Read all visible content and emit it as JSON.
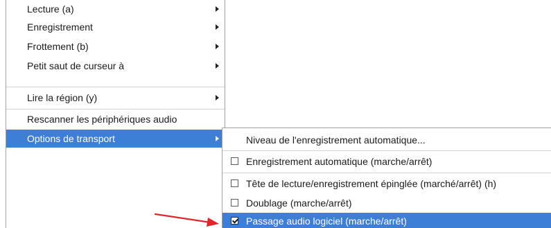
{
  "main_menu": {
    "items": [
      {
        "label": "Lecture (a)",
        "has_submenu": true
      },
      {
        "label": "Enregistrement",
        "has_submenu": true
      },
      {
        "label": "Frottement (b)",
        "has_submenu": true
      },
      {
        "label": "Petit saut de curseur à",
        "has_submenu": true
      },
      {
        "label": "Lire la région (y)",
        "has_submenu": true
      },
      {
        "label": "Rescanner les périphériques audio",
        "has_submenu": false
      },
      {
        "label": "Options de transport",
        "has_submenu": true,
        "active": true
      }
    ]
  },
  "transport_submenu": {
    "items": [
      {
        "label": "Niveau de l'enregistrement automatique...",
        "checkbox": false
      },
      {
        "label": "Enregistrement automatique (marche/arrêt)",
        "checkbox": true,
        "checked": false
      },
      {
        "label": "Tête de lecture/enregistrement épinglée (marché/arrêt) (h)",
        "checkbox": true,
        "checked": false
      },
      {
        "label": "Doublage (marche/arrêt)",
        "checkbox": true,
        "checked": false
      },
      {
        "label": "Passage audio logiciel (marche/arrêt)",
        "checkbox": true,
        "checked": true,
        "highlighted": true
      }
    ]
  },
  "colors": {
    "selection": "#3d7ed6",
    "annotation_arrow": "#e0262a",
    "border": "#a0a0a0"
  }
}
